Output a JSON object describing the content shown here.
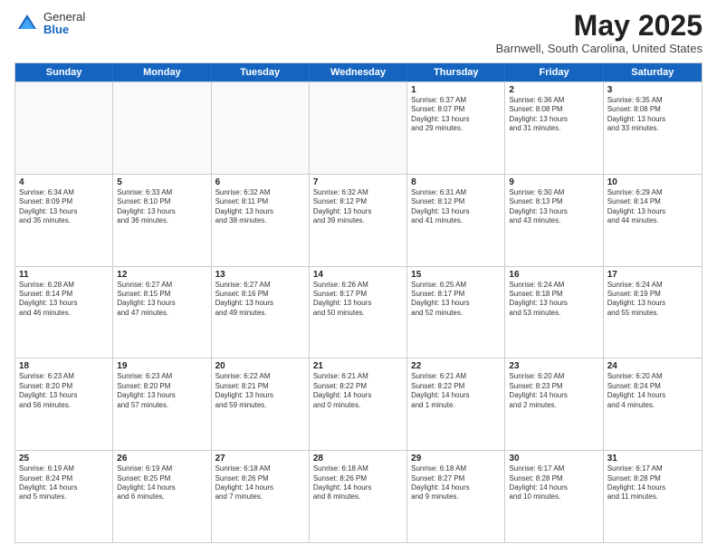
{
  "logo": {
    "general": "General",
    "blue": "Blue"
  },
  "title": "May 2025",
  "location": "Barnwell, South Carolina, United States",
  "weekdays": [
    "Sunday",
    "Monday",
    "Tuesday",
    "Wednesday",
    "Thursday",
    "Friday",
    "Saturday"
  ],
  "rows": [
    [
      {
        "day": "",
        "lines": []
      },
      {
        "day": "",
        "lines": []
      },
      {
        "day": "",
        "lines": []
      },
      {
        "day": "",
        "lines": []
      },
      {
        "day": "1",
        "lines": [
          "Sunrise: 6:37 AM",
          "Sunset: 8:07 PM",
          "Daylight: 13 hours",
          "and 29 minutes."
        ]
      },
      {
        "day": "2",
        "lines": [
          "Sunrise: 6:36 AM",
          "Sunset: 8:08 PM",
          "Daylight: 13 hours",
          "and 31 minutes."
        ]
      },
      {
        "day": "3",
        "lines": [
          "Sunrise: 6:35 AM",
          "Sunset: 8:08 PM",
          "Daylight: 13 hours",
          "and 33 minutes."
        ]
      }
    ],
    [
      {
        "day": "4",
        "lines": [
          "Sunrise: 6:34 AM",
          "Sunset: 8:09 PM",
          "Daylight: 13 hours",
          "and 35 minutes."
        ]
      },
      {
        "day": "5",
        "lines": [
          "Sunrise: 6:33 AM",
          "Sunset: 8:10 PM",
          "Daylight: 13 hours",
          "and 36 minutes."
        ]
      },
      {
        "day": "6",
        "lines": [
          "Sunrise: 6:32 AM",
          "Sunset: 8:11 PM",
          "Daylight: 13 hours",
          "and 38 minutes."
        ]
      },
      {
        "day": "7",
        "lines": [
          "Sunrise: 6:32 AM",
          "Sunset: 8:12 PM",
          "Daylight: 13 hours",
          "and 39 minutes."
        ]
      },
      {
        "day": "8",
        "lines": [
          "Sunrise: 6:31 AM",
          "Sunset: 8:12 PM",
          "Daylight: 13 hours",
          "and 41 minutes."
        ]
      },
      {
        "day": "9",
        "lines": [
          "Sunrise: 6:30 AM",
          "Sunset: 8:13 PM",
          "Daylight: 13 hours",
          "and 43 minutes."
        ]
      },
      {
        "day": "10",
        "lines": [
          "Sunrise: 6:29 AM",
          "Sunset: 8:14 PM",
          "Daylight: 13 hours",
          "and 44 minutes."
        ]
      }
    ],
    [
      {
        "day": "11",
        "lines": [
          "Sunrise: 6:28 AM",
          "Sunset: 8:14 PM",
          "Daylight: 13 hours",
          "and 46 minutes."
        ]
      },
      {
        "day": "12",
        "lines": [
          "Sunrise: 6:27 AM",
          "Sunset: 8:15 PM",
          "Daylight: 13 hours",
          "and 47 minutes."
        ]
      },
      {
        "day": "13",
        "lines": [
          "Sunrise: 6:27 AM",
          "Sunset: 8:16 PM",
          "Daylight: 13 hours",
          "and 49 minutes."
        ]
      },
      {
        "day": "14",
        "lines": [
          "Sunrise: 6:26 AM",
          "Sunset: 8:17 PM",
          "Daylight: 13 hours",
          "and 50 minutes."
        ]
      },
      {
        "day": "15",
        "lines": [
          "Sunrise: 6:25 AM",
          "Sunset: 8:17 PM",
          "Daylight: 13 hours",
          "and 52 minutes."
        ]
      },
      {
        "day": "16",
        "lines": [
          "Sunrise: 6:24 AM",
          "Sunset: 8:18 PM",
          "Daylight: 13 hours",
          "and 53 minutes."
        ]
      },
      {
        "day": "17",
        "lines": [
          "Sunrise: 6:24 AM",
          "Sunset: 8:19 PM",
          "Daylight: 13 hours",
          "and 55 minutes."
        ]
      }
    ],
    [
      {
        "day": "18",
        "lines": [
          "Sunrise: 6:23 AM",
          "Sunset: 8:20 PM",
          "Daylight: 13 hours",
          "and 56 minutes."
        ]
      },
      {
        "day": "19",
        "lines": [
          "Sunrise: 6:23 AM",
          "Sunset: 8:20 PM",
          "Daylight: 13 hours",
          "and 57 minutes."
        ]
      },
      {
        "day": "20",
        "lines": [
          "Sunrise: 6:22 AM",
          "Sunset: 8:21 PM",
          "Daylight: 13 hours",
          "and 59 minutes."
        ]
      },
      {
        "day": "21",
        "lines": [
          "Sunrise: 6:21 AM",
          "Sunset: 8:22 PM",
          "Daylight: 14 hours",
          "and 0 minutes."
        ]
      },
      {
        "day": "22",
        "lines": [
          "Sunrise: 6:21 AM",
          "Sunset: 8:22 PM",
          "Daylight: 14 hours",
          "and 1 minute."
        ]
      },
      {
        "day": "23",
        "lines": [
          "Sunrise: 6:20 AM",
          "Sunset: 8:23 PM",
          "Daylight: 14 hours",
          "and 2 minutes."
        ]
      },
      {
        "day": "24",
        "lines": [
          "Sunrise: 6:20 AM",
          "Sunset: 8:24 PM",
          "Daylight: 14 hours",
          "and 4 minutes."
        ]
      }
    ],
    [
      {
        "day": "25",
        "lines": [
          "Sunrise: 6:19 AM",
          "Sunset: 8:24 PM",
          "Daylight: 14 hours",
          "and 5 minutes."
        ]
      },
      {
        "day": "26",
        "lines": [
          "Sunrise: 6:19 AM",
          "Sunset: 8:25 PM",
          "Daylight: 14 hours",
          "and 6 minutes."
        ]
      },
      {
        "day": "27",
        "lines": [
          "Sunrise: 6:18 AM",
          "Sunset: 8:26 PM",
          "Daylight: 14 hours",
          "and 7 minutes."
        ]
      },
      {
        "day": "28",
        "lines": [
          "Sunrise: 6:18 AM",
          "Sunset: 8:26 PM",
          "Daylight: 14 hours",
          "and 8 minutes."
        ]
      },
      {
        "day": "29",
        "lines": [
          "Sunrise: 6:18 AM",
          "Sunset: 8:27 PM",
          "Daylight: 14 hours",
          "and 9 minutes."
        ]
      },
      {
        "day": "30",
        "lines": [
          "Sunrise: 6:17 AM",
          "Sunset: 8:28 PM",
          "Daylight: 14 hours",
          "and 10 minutes."
        ]
      },
      {
        "day": "31",
        "lines": [
          "Sunrise: 6:17 AM",
          "Sunset: 8:28 PM",
          "Daylight: 14 hours",
          "and 11 minutes."
        ]
      }
    ]
  ]
}
